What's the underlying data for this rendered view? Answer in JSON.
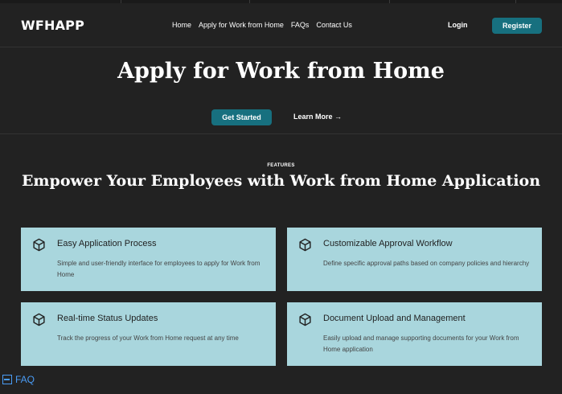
{
  "brand": {
    "logo": "WFHAPP"
  },
  "nav": {
    "items": [
      "Home",
      "Apply for Work from Home",
      "FAQs",
      "Contact Us"
    ]
  },
  "auth": {
    "login": "Login",
    "register": "Register"
  },
  "hero": {
    "title": "Apply for Work from Home",
    "primary_button": "Get Started",
    "secondary_button": "Learn More →"
  },
  "features": {
    "eyebrow": "FEATURES",
    "title": "Empower Your Employees with Work from Home Application",
    "cards": [
      {
        "icon": "cube-icon",
        "title": "Easy Application Process",
        "description": "Simple and user-friendly interface for employees to apply for Work from Home"
      },
      {
        "icon": "cube-icon",
        "title": "Customizable Approval Workflow",
        "description": "Define specific approval paths based on company policies and hierarchy"
      },
      {
        "icon": "cube-icon",
        "title": "Real-time Status Updates",
        "description": "Track the progress of your Work from Home request at any time"
      },
      {
        "icon": "cube-icon",
        "title": "Document Upload and Management",
        "description": "Easily upload and manage supporting documents for your Work from Home application"
      }
    ]
  },
  "faq_widget": {
    "label": "FAQ"
  },
  "colors": {
    "background": "#222222",
    "accent": "#17707f",
    "card": "#a9d6dd",
    "link": "#4a9cf5"
  }
}
